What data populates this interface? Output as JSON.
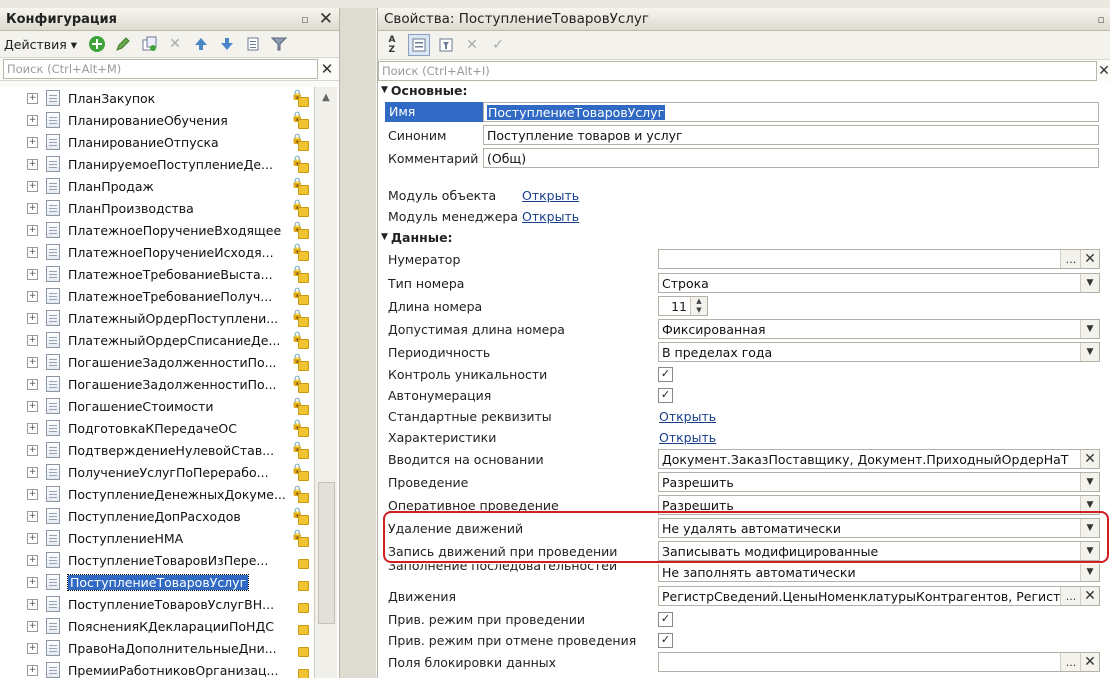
{
  "left_panel": {
    "title": "Конфигурация",
    "actions_label": "Действия",
    "search_placeholder": "Поиск (Ctrl+Alt+M)",
    "tree_items": [
      "ПланЗакупок",
      "ПланированиеОбучения",
      "ПланированиеОтпуска",
      "ПланируемоеПоступлениеДе...",
      "ПланПродаж",
      "ПланПроизводства",
      "ПлатежноеПоручениеВходящее",
      "ПлатежноеПоручениеИсходя...",
      "ПлатежноеТребованиеВыста...",
      "ПлатежноеТребованиеПолуч...",
      "ПлатежныйОрдерПоступлени...",
      "ПлатежныйОрдерСписаниеДе...",
      "ПогашениеЗадолженностиПо...",
      "ПогашениеЗадолженностиПо...",
      "ПогашениеСтоимости",
      "ПодготовкаКПередачеОС",
      "ПодтверждениеНулевойСтав...",
      "ПолучениеУслугПоПерерабо...",
      "ПоступлениеДенежныхДокуме...",
      "ПоступлениеДопРасходов",
      "ПоступлениеНМА",
      "ПоступлениеТоваровИзПере...",
      "ПоступлениеТоваровУслуг",
      "ПоступлениеТоваровУслугВН...",
      "ПоясненияКДекларацииПоНДС",
      "ПравоНаДополнительныеДни...",
      "ПремииРаботниковОрганизац..."
    ],
    "selected_item": "ПоступлениеТоваровУслуг"
  },
  "right_panel": {
    "title": "Свойства: ПоступлениеТоваровУслуг",
    "search_placeholder": "Поиск (Ctrl+Alt+I)",
    "group_main": "Основные:",
    "group_data": "Данные:",
    "name_label": "Имя",
    "name_value": "ПоступлениеТоваровУслуг",
    "synonym_label": "Синоним",
    "synonym_value": "Поступление товаров и услуг",
    "comment_label": "Комментарий",
    "comment_value": "(Общ)",
    "object_module_label": "Модуль объекта",
    "manager_module_label": "Модуль менеджера",
    "open_link": "Открыть",
    "numerator_label": "Нумератор",
    "number_type_label": "Тип номера",
    "number_type_value": "Строка",
    "number_length_label": "Длина номера",
    "number_length_value": "11",
    "allowed_length_label": "Допустимая длина номера",
    "allowed_length_value": "Фиксированная",
    "periodicity_label": "Периодичность",
    "periodicity_value": "В пределах года",
    "uniqueness_label": "Контроль уникальности",
    "autonumbering_label": "Автонумерация",
    "std_attributes_label": "Стандартные реквизиты",
    "characteristics_label": "Характеристики",
    "based_on_label": "Вводится на основании",
    "based_on_value": "Документ.ЗаказПоставщику, Документ.ПриходныйОрдерНаТ",
    "posting_label": "Проведение",
    "posting_value": "Разрешить",
    "realtime_posting_label": "Оперативное проведение",
    "realtime_posting_value": "Разрешить",
    "delete_movements_label": "Удаление движений",
    "delete_movements_value": "Не удалять автоматически",
    "write_movements_label": "Запись движений при проведении",
    "write_movements_value": "Записывать модифицированные",
    "seq_fill_label": "Заполнение последовательностей",
    "seq_fill_value": "Не заполнять автоматически",
    "movements_label": "Движения",
    "movements_value": "РегистрСведений.ЦеныНоменклатурыКонтрагентов, Регистр",
    "priv_posting_label": "Прив. режим при проведении",
    "priv_unposting_label": "Прив. режим при отмене проведения",
    "lock_fields_label": "Поля блокировки данных"
  }
}
